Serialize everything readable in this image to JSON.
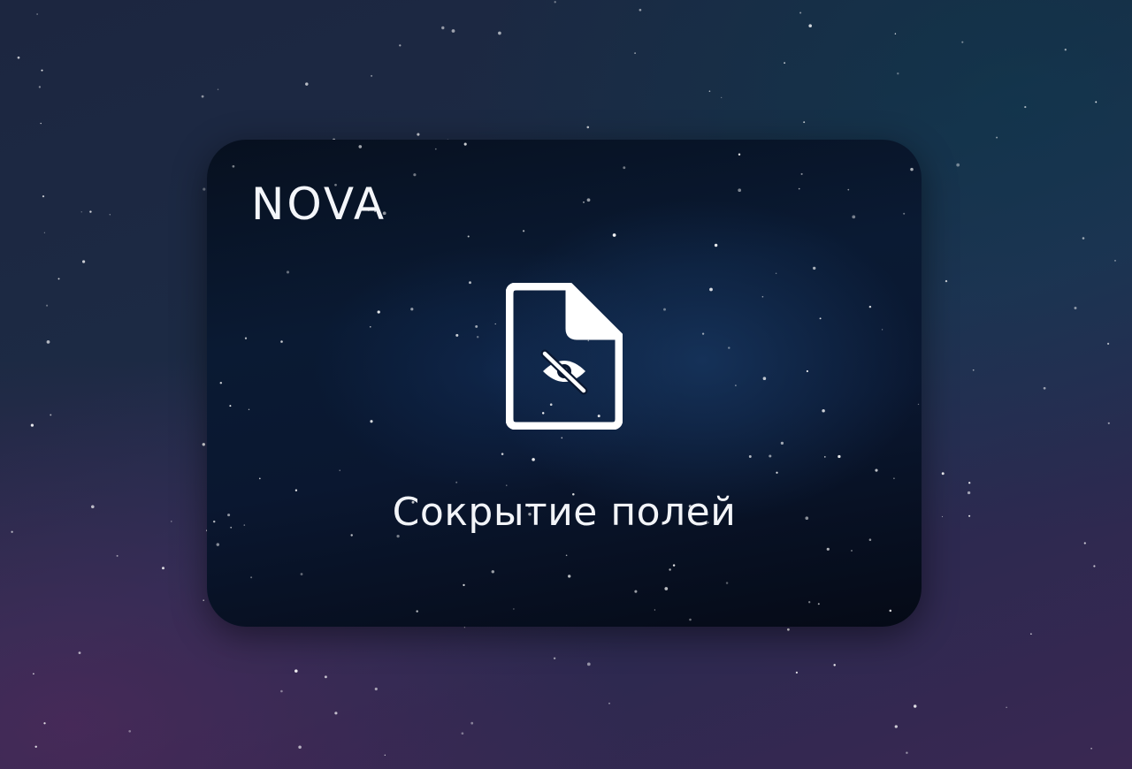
{
  "brand": {
    "name": "NOVA"
  },
  "feature": {
    "icon": "document-hidden-eye-icon",
    "caption": "Сокрытие полей"
  },
  "colors": {
    "text": "#f4f6fa",
    "card_dark": "#07101f",
    "card_glow": "#1e4678",
    "bg_top": "#1c2640",
    "bg_bottom": "#3a2852"
  }
}
